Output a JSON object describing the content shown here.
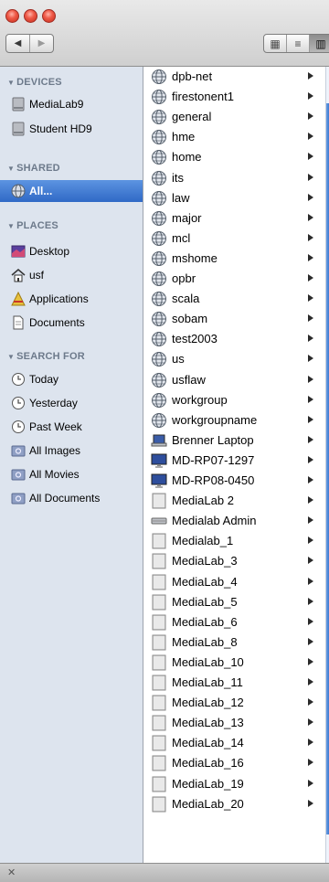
{
  "toolbar": {
    "nav_back": "◀",
    "nav_forward": "▶",
    "view_icon": "▦",
    "view_list": "≡",
    "view_column": "▥"
  },
  "sidebar": {
    "devices_header": "DEVICES",
    "devices": [
      {
        "label": "MediaLab9",
        "icon": "hard-drive-icon"
      },
      {
        "label": "Student HD9",
        "icon": "hard-drive-icon"
      }
    ],
    "shared_header": "SHARED",
    "shared": [
      {
        "label": "All...",
        "icon": "network-globe-icon",
        "selected": true
      }
    ],
    "places_header": "PLACES",
    "places": [
      {
        "label": "Desktop",
        "icon": "desktop-icon"
      },
      {
        "label": "usf",
        "icon": "home-icon"
      },
      {
        "label": "Applications",
        "icon": "applications-icon"
      },
      {
        "label": "Documents",
        "icon": "documents-icon"
      }
    ],
    "search_header": "SEARCH FOR",
    "searches": [
      {
        "label": "Today",
        "icon": "clock-icon"
      },
      {
        "label": "Yesterday",
        "icon": "clock-icon"
      },
      {
        "label": "Past Week",
        "icon": "clock-icon"
      },
      {
        "label": "All Images",
        "icon": "smart-folder-icon"
      },
      {
        "label": "All Movies",
        "icon": "smart-folder-icon"
      },
      {
        "label": "All Documents",
        "icon": "smart-folder-icon"
      }
    ]
  },
  "column": {
    "items": [
      {
        "label": "dpb-net",
        "icon": "workgroup-icon"
      },
      {
        "label": "firestonent1",
        "icon": "workgroup-icon"
      },
      {
        "label": "general",
        "icon": "workgroup-icon"
      },
      {
        "label": "hme",
        "icon": "workgroup-icon"
      },
      {
        "label": "home",
        "icon": "workgroup-icon"
      },
      {
        "label": "its",
        "icon": "workgroup-icon"
      },
      {
        "label": "law",
        "icon": "workgroup-icon"
      },
      {
        "label": "major",
        "icon": "workgroup-icon"
      },
      {
        "label": "mcl",
        "icon": "workgroup-icon"
      },
      {
        "label": "mshome",
        "icon": "workgroup-icon"
      },
      {
        "label": "opbr",
        "icon": "workgroup-icon"
      },
      {
        "label": "scala",
        "icon": "workgroup-icon"
      },
      {
        "label": "sobam",
        "icon": "workgroup-icon"
      },
      {
        "label": "test2003",
        "icon": "workgroup-icon"
      },
      {
        "label": "us",
        "icon": "workgroup-icon"
      },
      {
        "label": "usflaw",
        "icon": "workgroup-icon"
      },
      {
        "label": "workgroup",
        "icon": "workgroup-icon"
      },
      {
        "label": "workgroupname",
        "icon": "workgroup-icon"
      },
      {
        "label": "Brenner Laptop",
        "icon": "laptop-icon"
      },
      {
        "label": "MD-RP07-1297",
        "icon": "monitor-icon"
      },
      {
        "label": "MD-RP08-0450",
        "icon": "monitor-icon"
      },
      {
        "label": "MediaLab 2",
        "icon": "server-icon"
      },
      {
        "label": "Medialab Admin",
        "icon": "xserve-icon"
      },
      {
        "label": "Medialab_1",
        "icon": "server-icon"
      },
      {
        "label": "MediaLab_3",
        "icon": "server-icon"
      },
      {
        "label": "MediaLab_4",
        "icon": "server-icon"
      },
      {
        "label": "MediaLab_5",
        "icon": "server-icon"
      },
      {
        "label": "MediaLab_6",
        "icon": "server-icon"
      },
      {
        "label": "MediaLab_8",
        "icon": "server-icon"
      },
      {
        "label": "MediaLab_10",
        "icon": "server-icon"
      },
      {
        "label": "MediaLab_11",
        "icon": "server-icon"
      },
      {
        "label": "MediaLab_12",
        "icon": "server-icon"
      },
      {
        "label": "MediaLab_13",
        "icon": "server-icon"
      },
      {
        "label": "MediaLab_14",
        "icon": "server-icon"
      },
      {
        "label": "MediaLab_16",
        "icon": "server-icon"
      },
      {
        "label": "MediaLab_19",
        "icon": "server-icon"
      },
      {
        "label": "MediaLab_20",
        "icon": "server-icon"
      }
    ]
  },
  "colors": {
    "sidebar_bg": "#dde4ee",
    "selection": "#2f69c6",
    "section_header": "#6d7a8b"
  }
}
